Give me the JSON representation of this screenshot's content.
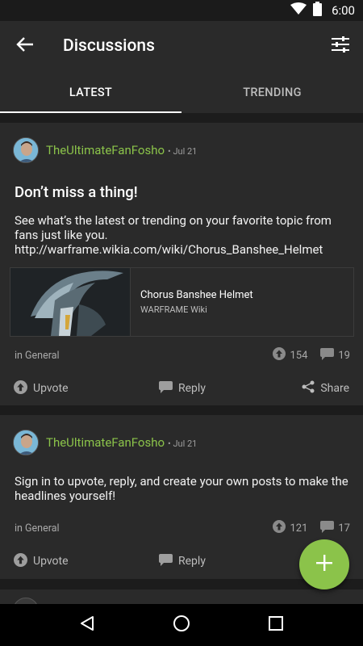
{
  "status_bar": {
    "time": "6:00",
    "icons": [
      "wifi-icon",
      "battery-icon"
    ]
  },
  "app_bar": {
    "title": "Discussions",
    "back_icon": "arrow-back-icon",
    "filter_icon": "tune-icon"
  },
  "tabs": [
    {
      "label": "LATEST",
      "active": true
    },
    {
      "label": "TRENDING",
      "active": false
    }
  ],
  "posts": [
    {
      "author": "TheUltimateFanFosho",
      "date": "• Jul 21",
      "title": "Don’t miss a thing!",
      "body": "See what’s the latest or trending on your favorite topic from fans just like you. http://warframe.wikia.com/wiki/Chorus_Banshee_Helmet",
      "link_preview": {
        "title": "Chorus Banshee Helmet",
        "source": "WARFRAME Wiki"
      },
      "category": "in General",
      "upvotes": "154",
      "replies": "19",
      "actions": {
        "upvote": "Upvote",
        "reply": "Reply",
        "share": "Share"
      }
    },
    {
      "author": "TheUltimateFanFosho",
      "date": "• Jul 21",
      "body": "Sign in to upvote, reply, and create your own posts to make the headlines yourself!",
      "category": "in General",
      "upvotes": "121",
      "replies": "17",
      "actions": {
        "upvote": "Upvote",
        "reply": "Reply"
      }
    }
  ],
  "fab": {
    "icon": "plus-icon"
  },
  "colors": {
    "accent": "#8bc34a",
    "app_bar": "#2a2a2a",
    "background": "#1c1c1c"
  }
}
